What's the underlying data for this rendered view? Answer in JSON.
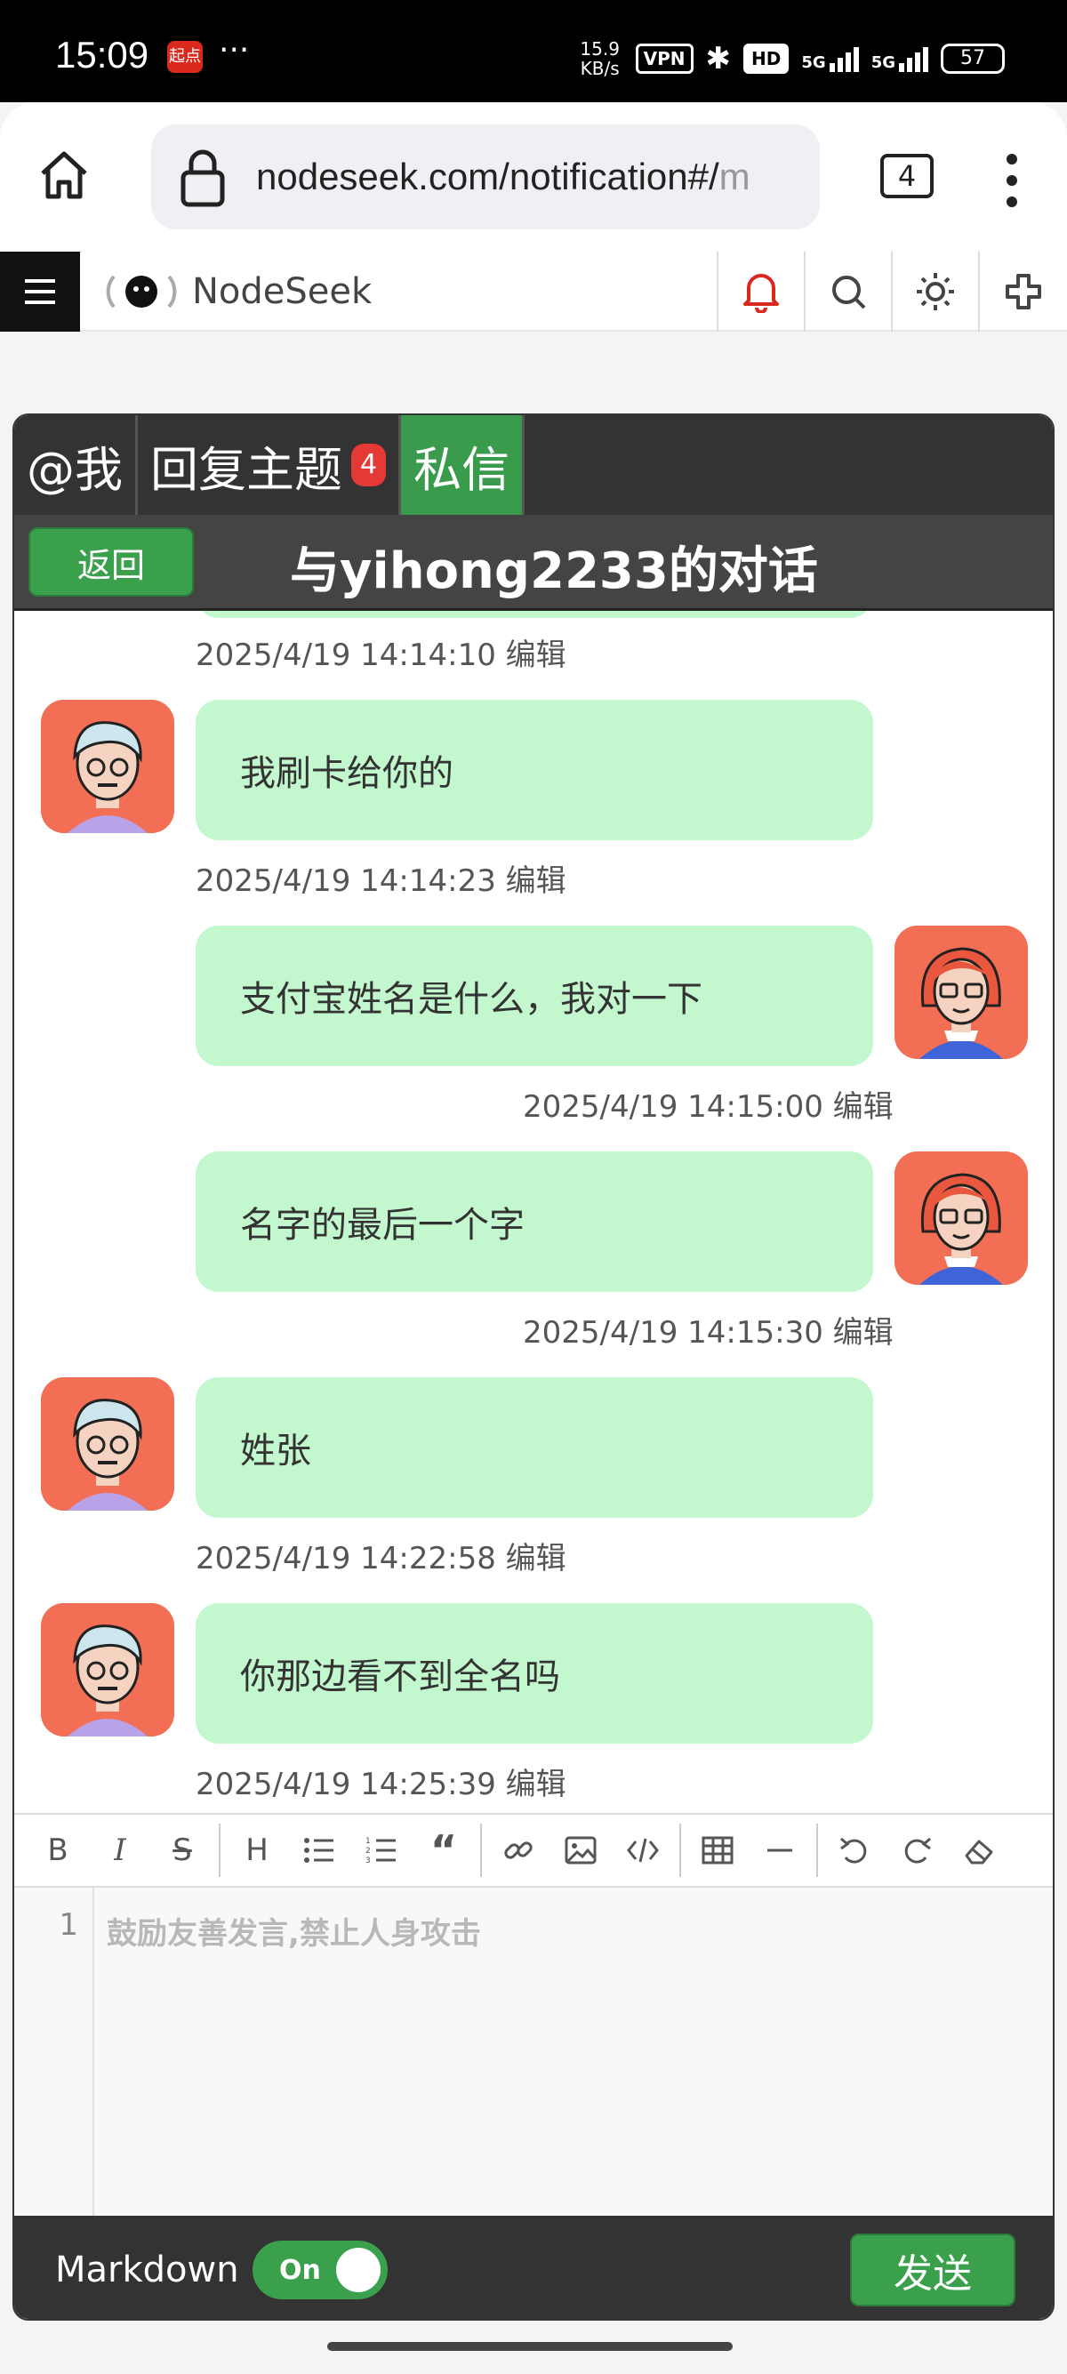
{
  "status_bar": {
    "time": "15:09",
    "app_icon_text": "起点",
    "more": "···",
    "net_speed": "15.9 KB/s",
    "vpn": "VPN",
    "hd": "HD",
    "signal1": "5G",
    "signal2": "5G",
    "battery": "57"
  },
  "browser": {
    "url_main": "nodeseek.com/notification#/",
    "url_faded": "m",
    "tab_count": "4"
  },
  "site": {
    "logo_text": "NodeSeek",
    "accent": "#3aa04c",
    "bell_color": "#d9281c"
  },
  "tabs": [
    {
      "label": "@我"
    },
    {
      "label": "回复主题",
      "badge": "4"
    },
    {
      "label": "私信"
    }
  ],
  "conversation": {
    "back_label": "返回",
    "title_prefix": "与",
    "title_user": "yihong2233",
    "title_suffix": "的对话"
  },
  "messages": [
    {
      "side": "left",
      "text": "我刷卡给你的",
      "time": "2025/4/19 14:14:23",
      "edit": "编辑"
    },
    {
      "side": "right",
      "text": "支付宝姓名是什么，我对一下",
      "time": "2025/4/19 14:15:00",
      "edit": "编辑"
    },
    {
      "side": "right",
      "text": "名字的最后一个字",
      "time": "2025/4/19 14:15:30",
      "edit": "编辑"
    },
    {
      "side": "left",
      "text": "姓张",
      "time": "2025/4/19 14:22:58",
      "edit": "编辑"
    },
    {
      "side": "left",
      "text": "你那边看不到全名吗",
      "time": "2025/4/19 14:25:39",
      "edit": "编辑"
    }
  ],
  "prev_message_meta": {
    "time": "2025/4/19 14:14:10",
    "edit": "编辑"
  },
  "toolbar": {
    "bold": "B",
    "italic": "I",
    "strike": "S",
    "heading": "H",
    "quote": "“"
  },
  "editor": {
    "line_number": "1",
    "placeholder": "鼓励友善发言,禁止人身攻击"
  },
  "footer": {
    "markdown_label": "Markdown",
    "toggle_label": "On",
    "send_label": "发送"
  }
}
